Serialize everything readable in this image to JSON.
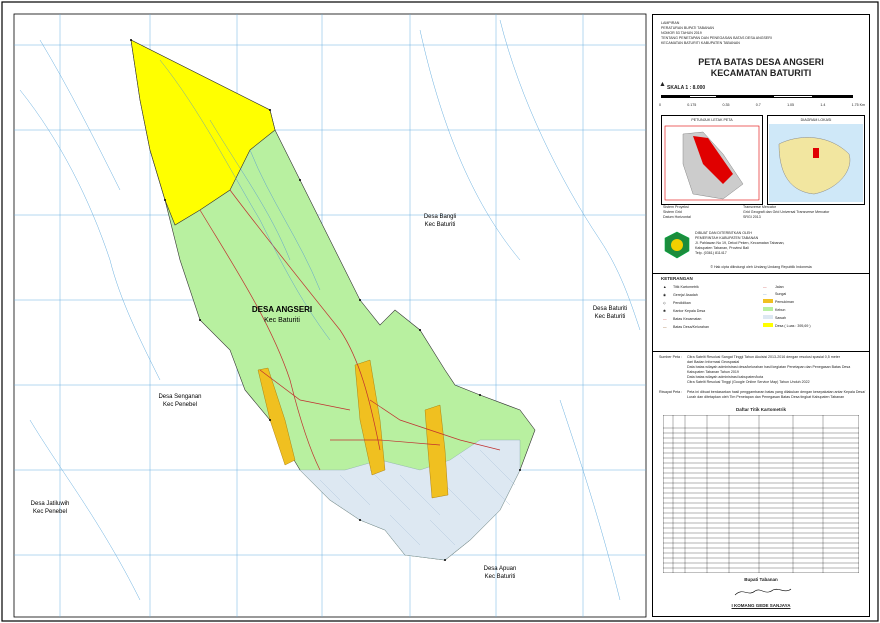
{
  "map": {
    "main_label": "DESA ANGSERI",
    "main_label_sub": "Kec Baturiti",
    "neighbors": [
      {
        "name": "Desa Bangli",
        "sub": "Kec Baturiti"
      },
      {
        "name": "Desa Baturiti",
        "sub": "Kec Baturiti"
      },
      {
        "name": "Desa Senganan",
        "sub": "Kec Penebel"
      },
      {
        "name": "Desa Jatiluwih",
        "sub": "Kec Penebel"
      },
      {
        "name": "Desa Apuan",
        "sub": "Kec Baturiti"
      }
    ],
    "colors": {
      "forest": "#ffff00",
      "field": "#b8f0a0",
      "settlement": "#f0c020",
      "paddy": "#dde8f2",
      "water": "#4a8fd8",
      "road": "#c03030",
      "grid": "#6ab0e0"
    }
  },
  "side": {
    "lampiran": [
      "LAMPIRAN",
      "PERATURAN BUPATI TABANAN",
      "NOMOR 53 TAHUN 2019",
      "TENTANG PENETAPAN DAN PENEGASAN BATAS DESA ANGSERI",
      "KECAMATAN BATURITI KABUPATEN TABANAN"
    ],
    "title1": "PETA BATAS DESA ANGSERI",
    "title2": "KECAMATAN BATURITI",
    "scale_text": "SKALA 1 : 8.000",
    "scale_ticks": [
      "0",
      "0.175",
      "0.35",
      "0.7",
      "1.05",
      "1.4",
      "1.75 Km"
    ],
    "inset1_title": "PETUNJUK LETAK PETA",
    "inset2_title": "DIAGRAM LOKASI",
    "projection": [
      {
        "k": "Sistem Proyeksi",
        "v": "Transverse Mercator"
      },
      {
        "k": "Sistem Grid",
        "v": "Grid Geografi dan Grid Universal Transverse Mercator"
      },
      {
        "k": "Datum Horizontal",
        "v": "SRGI 2013"
      }
    ],
    "publisher": [
      "DIBUAT DAN DITERBITKAN OLEH",
      "PEMERINTAH KABUPATEN TABANAN",
      "Jl. Pahlawan No 19, Delod Peken, Kecamatan Tabanan,",
      "Kabupaten Tabanan, Provinsi Bali",
      "Telp. (0361) 811417"
    ],
    "copyright": "© Hak cipta dilindungi oleh Undang Undang Republik Indonesia",
    "keterangan": "KETERANGAN",
    "legend_left": [
      "Titik Kartometrik",
      "Gereja/ Asadah",
      "Pendidikan",
      "Kantor Kepala Desa",
      "Batas Kecamatan",
      "Batas Desa/Kelurahan"
    ],
    "legend_right": [
      "Jalan",
      "Sungai",
      "Pemukiman",
      "Kebun",
      "Sawah",
      "Desa ( Luas : 395,69 )"
    ],
    "sumber_label": "Sumber Peta :",
    "sumber": [
      "Citra Satelit Resolusi Sangat Tinggi Tahun Akuisisi 2013-2016 dengan resolusi spasial 0,5 meter",
      "dari Badan Informasi Geospasial",
      "Data batas wilayah administrasi desa/kelurahan hasil kegiatan Penetapan dan Penegasan Batas Desa",
      "Kabupaten Tabanan Tahun 2019",
      "Data batas wilayah administrasi kabupaten/kota",
      "Citra Satelit Resolusi Tinggi (Google Online Service Map) Tahun Unduh 2022"
    ],
    "riwayat_label": "Riwayat Peta :",
    "riwayat": [
      "Peta ini dibuat berdasarkan hasil penggambaran batas yang dilakukan dengan kesepakatan antar Kepala Desa/",
      "Lurah dan ditetapkan oleh Tim Penetapan dan Penegasan Batas Desa tingkat Kabupaten Tabanan"
    ],
    "table_title": "Daftar Titik Kartometrik",
    "sign_title": "Bupati Tabanan",
    "sign_name": "I KOMANG GEDE SANJAYA"
  }
}
